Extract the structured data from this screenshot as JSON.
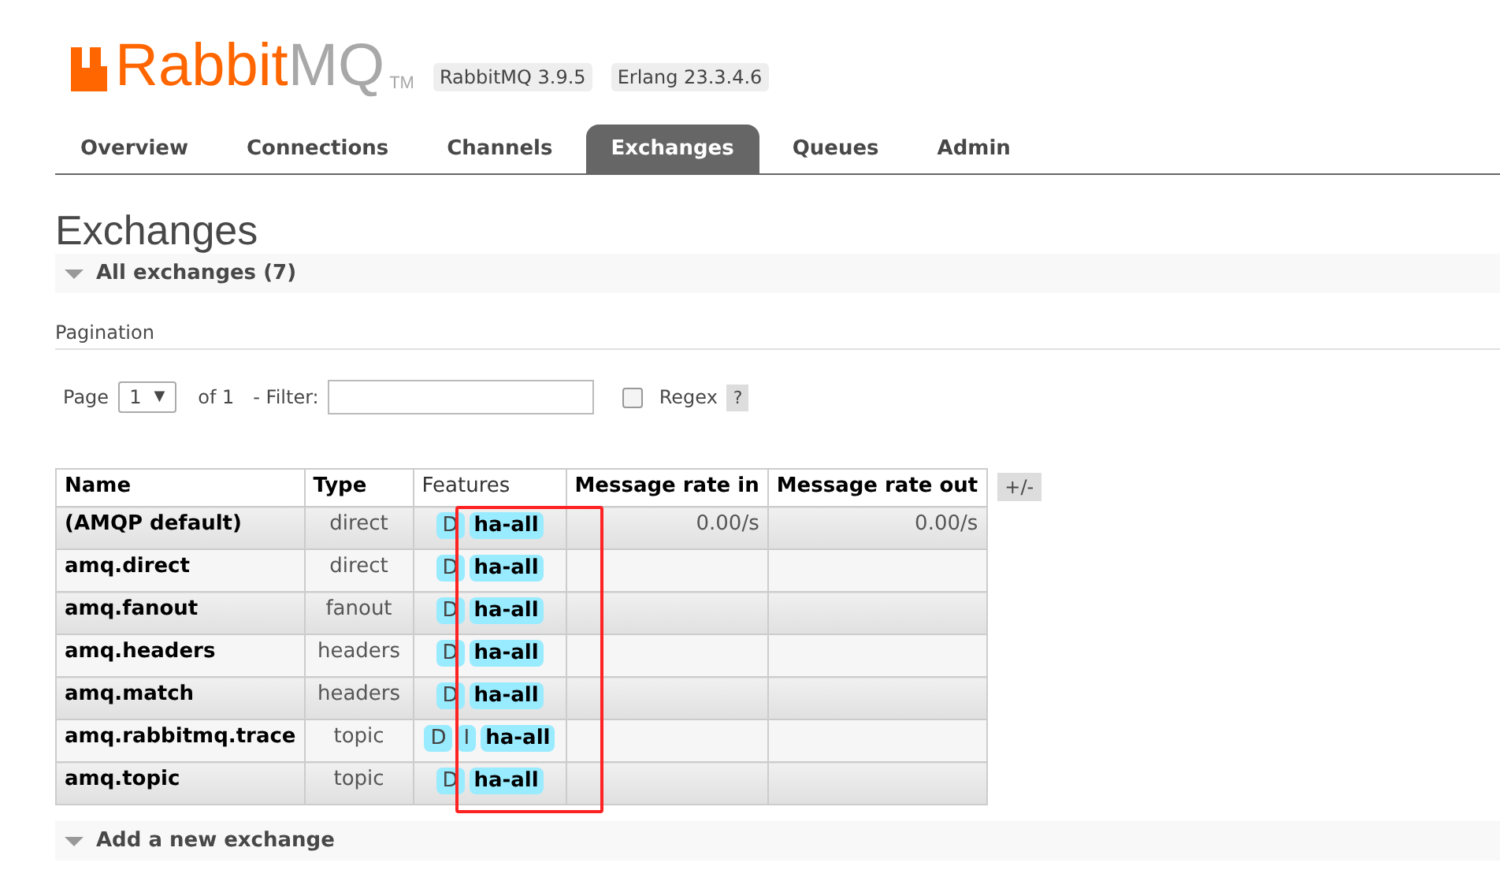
{
  "header": {
    "logo": {
      "brand": "Rabbit",
      "product": "MQ",
      "mark": "TM"
    },
    "versions": [
      "RabbitMQ 3.9.5",
      "Erlang 23.3.4.6"
    ]
  },
  "tabs": [
    {
      "label": "Overview",
      "selected": false
    },
    {
      "label": "Connections",
      "selected": false
    },
    {
      "label": "Channels",
      "selected": false
    },
    {
      "label": "Exchanges",
      "selected": true
    },
    {
      "label": "Queues",
      "selected": false
    },
    {
      "label": "Admin",
      "selected": false
    }
  ],
  "page_title": "Exchanges",
  "section": {
    "title": "All exchanges (7)",
    "expanded": true
  },
  "pagination": {
    "label": "Pagination",
    "page_label": "Page",
    "page": "1",
    "caret": "▼",
    "of": "of 1",
    "filter_label": "- Filter:",
    "regex_label": "Regex",
    "regex_checked": false,
    "help": "?"
  },
  "table": {
    "columns": [
      "Name",
      "Type",
      "Features",
      "Message rate in",
      "Message rate out"
    ],
    "toggle": "+/-",
    "rows": [
      {
        "name": "(AMQP default)",
        "type": "direct",
        "features": [
          {
            "text": "D",
            "kind": "flag"
          },
          {
            "text": "ha-all",
            "kind": "policy"
          }
        ],
        "rate_in": "0.00/s",
        "rate_out": "0.00/s"
      },
      {
        "name": "amq.direct",
        "type": "direct",
        "features": [
          {
            "text": "D",
            "kind": "flag"
          },
          {
            "text": "ha-all",
            "kind": "policy"
          }
        ]
      },
      {
        "name": "amq.fanout",
        "type": "fanout",
        "features": [
          {
            "text": "D",
            "kind": "flag"
          },
          {
            "text": "ha-all",
            "kind": "policy"
          }
        ]
      },
      {
        "name": "amq.headers",
        "type": "headers",
        "features": [
          {
            "text": "D",
            "kind": "flag"
          },
          {
            "text": "ha-all",
            "kind": "policy"
          }
        ]
      },
      {
        "name": "amq.match",
        "type": "headers",
        "features": [
          {
            "text": "D",
            "kind": "flag"
          },
          {
            "text": "ha-all",
            "kind": "policy"
          }
        ]
      },
      {
        "name": "amq.rabbitmq.trace",
        "type": "topic",
        "features": [
          {
            "text": "D",
            "kind": "flag"
          },
          {
            "text": "I",
            "kind": "flag"
          },
          {
            "text": "ha-all",
            "kind": "policy"
          }
        ]
      },
      {
        "name": "amq.topic",
        "type": "topic",
        "features": [
          {
            "text": "D",
            "kind": "flag"
          },
          {
            "text": "ha-all",
            "kind": "policy"
          }
        ]
      }
    ]
  },
  "annotation": {
    "kind": "outline"
  },
  "add_section": {
    "title": "Add a new exchange",
    "expanded": true
  }
}
